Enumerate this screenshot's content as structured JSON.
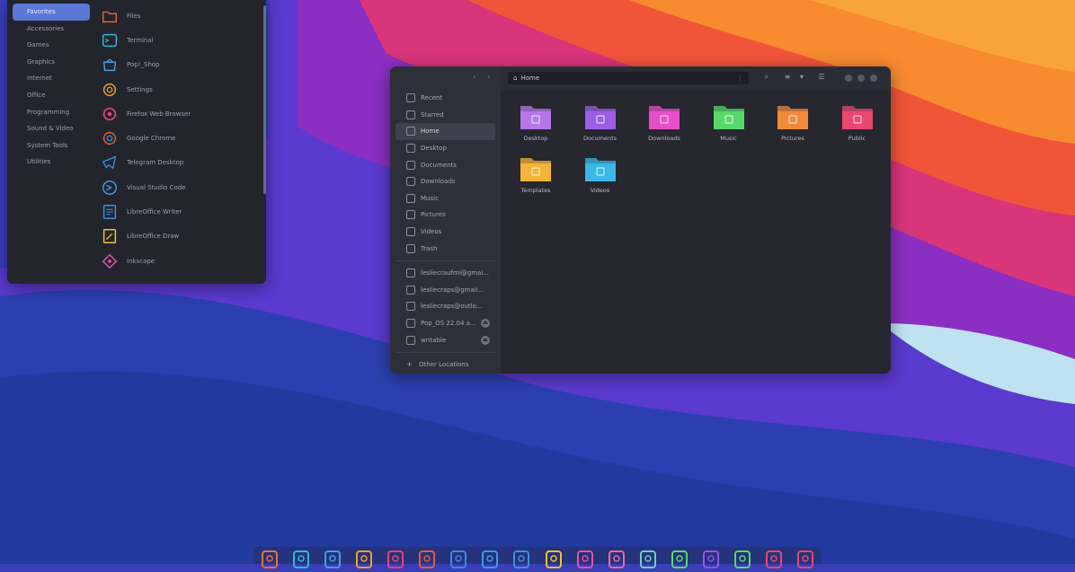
{
  "app_menu": {
    "categories": [
      {
        "label": "Favorites",
        "active": true
      },
      {
        "label": "Accessories"
      },
      {
        "label": "Games"
      },
      {
        "label": "Graphics"
      },
      {
        "label": "Internet"
      },
      {
        "label": "Office"
      },
      {
        "label": "Programming"
      },
      {
        "label": "Sound & Video"
      },
      {
        "label": "System Tools"
      },
      {
        "label": "Utilities"
      }
    ],
    "apps": [
      {
        "label": "Files",
        "icon": "folder-icon",
        "color": "#e0653a"
      },
      {
        "label": "Terminal",
        "icon": "terminal-icon",
        "color": "#2fb8d8"
      },
      {
        "label": "Pop!_Shop",
        "icon": "shop-icon",
        "color": "#3fa0e8"
      },
      {
        "label": "Settings",
        "icon": "gear-icon",
        "color": "#f0a030"
      },
      {
        "label": "Firefox Web Browser",
        "icon": "firefox-icon",
        "color": "#e8407a"
      },
      {
        "label": "Google Chrome",
        "icon": "chrome-icon",
        "color": "#e85a3a"
      },
      {
        "label": "Telegram Desktop",
        "icon": "telegram-icon",
        "color": "#3a8ae8"
      },
      {
        "label": "Visual Studio Code",
        "icon": "vscode-icon",
        "color": "#3a9ae8"
      },
      {
        "label": "LibreOffice Writer",
        "icon": "writer-icon",
        "color": "#3a90e0"
      },
      {
        "label": "LibreOffice Draw",
        "icon": "draw-icon",
        "color": "#f0c030"
      },
      {
        "label": "Inkscape",
        "icon": "inkscape-icon",
        "color": "#e850a0"
      }
    ]
  },
  "file_manager": {
    "path": "Home",
    "sidebar": [
      {
        "label": "Recent"
      },
      {
        "label": "Starred"
      },
      {
        "label": "Home",
        "active": true
      },
      {
        "label": "Desktop"
      },
      {
        "label": "Documents"
      },
      {
        "label": "Downloads"
      },
      {
        "label": "Music"
      },
      {
        "label": "Pictures"
      },
      {
        "label": "Videos"
      },
      {
        "label": "Trash"
      }
    ],
    "accounts": [
      {
        "label": "lesliecraufmi@gmai..."
      },
      {
        "label": "lesliecraps@gmail..."
      },
      {
        "label": "lesliecraps@outlo..."
      },
      {
        "label": "Pop_OS 22.04 a...",
        "eject": true
      },
      {
        "label": "writable",
        "eject": true
      }
    ],
    "other_locations": "Other Locations",
    "folders": [
      {
        "label": "Desktop",
        "color": "#b577e8"
      },
      {
        "label": "Documents",
        "color": "#9b5fe6"
      },
      {
        "label": "Downloads",
        "color": "#e64fc8"
      },
      {
        "label": "Music",
        "color": "#56d96a"
      },
      {
        "label": "Pictures",
        "color": "#f08a3a"
      },
      {
        "label": "Public",
        "color": "#e8476f"
      },
      {
        "label": "Templates",
        "color": "#f4b43a"
      },
      {
        "label": "Videos",
        "color": "#3ab8e8"
      }
    ]
  },
  "dock": {
    "items": [
      {
        "icon": "folder-icon",
        "color": "#e8703a"
      },
      {
        "icon": "terminal-icon",
        "color": "#2fb8d8"
      },
      {
        "icon": "shop-icon",
        "color": "#3fa0e8"
      },
      {
        "icon": "gear-icon",
        "color": "#f0a030"
      },
      {
        "icon": "firefox-icon",
        "color": "#e8407a"
      },
      {
        "icon": "chrome-icon",
        "color": "#e85a3a"
      },
      {
        "icon": "telegram-icon",
        "color": "#3a8ae8"
      },
      {
        "icon": "vscode-icon",
        "color": "#3a9ae8"
      },
      {
        "icon": "writer-icon",
        "color": "#3a90e0"
      },
      {
        "icon": "draw-icon",
        "color": "#f0c030"
      },
      {
        "icon": "inkscape-icon",
        "color": "#e850a0"
      },
      {
        "icon": "image-icon",
        "color": "#e86a9a"
      },
      {
        "icon": "monitor-icon",
        "color": "#6ad0c0"
      },
      {
        "icon": "chat-icon",
        "color": "#56d96a"
      },
      {
        "icon": "app-icon",
        "color": "#9b4fe8"
      },
      {
        "icon": "puzzle-icon",
        "color": "#56d96a"
      },
      {
        "icon": "store-icon",
        "color": "#e8476f"
      },
      {
        "icon": "store2-icon",
        "color": "#e8476f"
      }
    ]
  }
}
